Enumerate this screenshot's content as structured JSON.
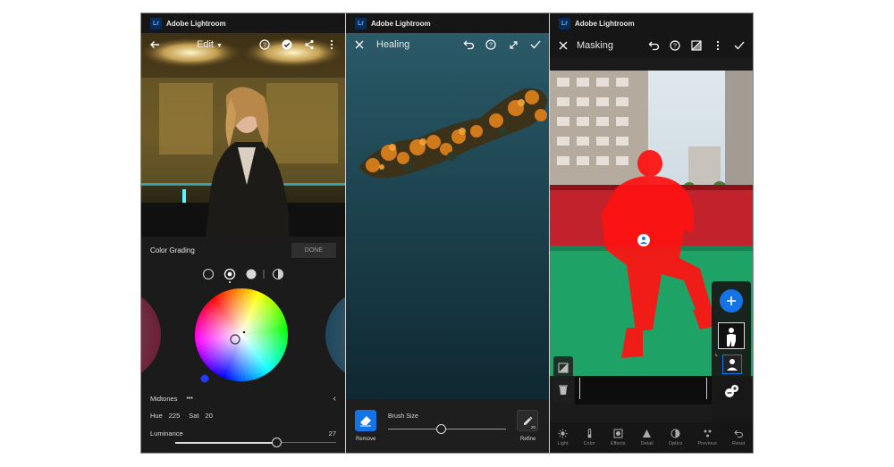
{
  "colors": {
    "lr_badge": "#0a2c58",
    "accent_blue": "#1473e6",
    "mask_red": "#ff1212",
    "panel_bg": "#1b1b1b"
  },
  "app": {
    "badge": "Lr",
    "title": "Adobe Lightroom"
  },
  "edit_screen": {
    "toolbar": {
      "title": "Edit",
      "icons": [
        "back-arrow-icon",
        "help-icon",
        "done-check-icon",
        "share-icon",
        "more-icon"
      ]
    },
    "panel_title": "Color Grading",
    "done_label": "DONE",
    "mode_icons": [
      "shadows-circle-icon",
      "midtones-circle-icon",
      "highlights-circle-icon",
      "global-half-circle-icon"
    ],
    "selected_mode": "Midtones",
    "section_label": "Midtones",
    "more_label": "•••",
    "hue_label": "Hue",
    "hue_value": "225",
    "sat_label": "Sat",
    "sat_value": "20",
    "luminance_label": "Luminance",
    "luminance_value": "27",
    "luminance_fraction": 0.63
  },
  "healing_screen": {
    "toolbar": {
      "title": "Healing",
      "icons": [
        "close-icon",
        "undo-icon",
        "help-icon",
        "expand-icon",
        "check-icon"
      ]
    },
    "brush_label": "Brush Size",
    "brush_fraction": 0.45,
    "remove_label": "Remove",
    "refine_label": "Refine",
    "refine_badge": "20"
  },
  "masking_screen": {
    "toolbar": {
      "title": "Masking",
      "icons": [
        "close-icon",
        "undo-icon",
        "help-icon",
        "mask-overlay-icon",
        "more-icon",
        "check-icon"
      ]
    },
    "side_tools": [
      "add-mask-icon",
      "subject-mask-icon",
      "person-mask-icon",
      "subtract-mask-icon"
    ],
    "left_tools": [
      "invert-icon",
      "trash-icon"
    ],
    "bottom_tabs": [
      "Light",
      "Color",
      "Effects",
      "Detail",
      "Optics",
      "Previous",
      "Reset"
    ]
  }
}
